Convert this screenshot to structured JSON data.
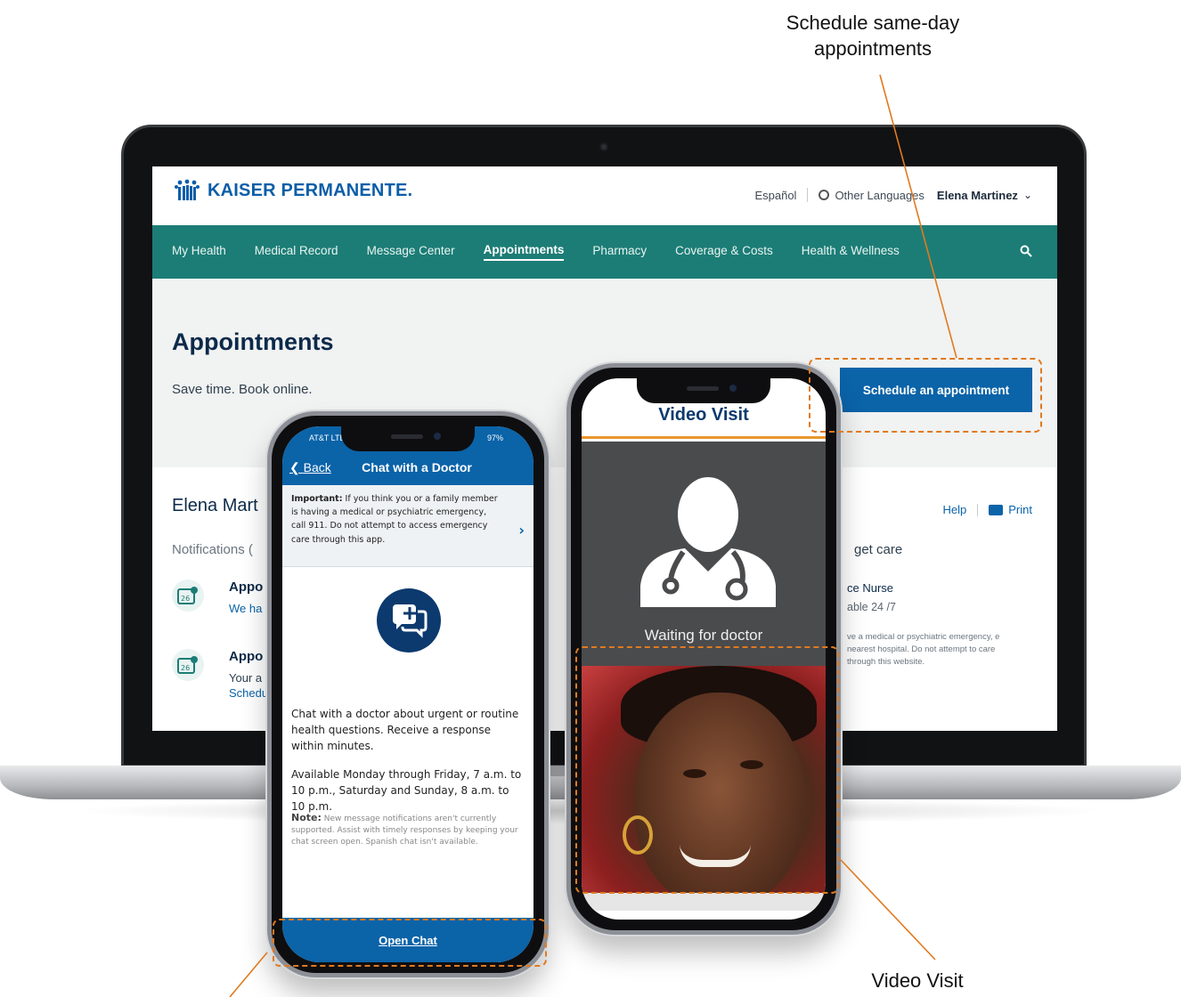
{
  "callouts": {
    "top_line1": "Schedule same-day",
    "top_line2": "appointments",
    "bottom": "Video Visit"
  },
  "colors": {
    "nav_teal": "#1c7d76",
    "brand_blue": "#0b63a8",
    "callout_orange": "#e07a1f"
  },
  "laptop": {
    "logo_text": "KAISER PERMANENTE.",
    "utility": {
      "espanol": "Español",
      "other_languages": "Other Languages",
      "user": "Elena Martinez"
    },
    "nav": [
      "My Health",
      "Medical Record",
      "Message Center",
      "Appointments",
      "Pharmacy",
      "Coverage & Costs",
      "Health & Wellness"
    ],
    "nav_active": "Appointments",
    "hero": {
      "title": "Appointments",
      "subtitle": "Save time. Book online.",
      "schedule_button": "Schedule an appointment"
    },
    "body": {
      "member_name": "Elena Mart",
      "help": "Help",
      "print": "Print",
      "notifications": "Notifications (",
      "get_care": "get care",
      "appt1_title": "Appo",
      "appt1_line": "We ha",
      "appt2_title": "Appo",
      "appt2_line1": "Your a",
      "appt2_line2": "Schedu",
      "nurse": "ce Nurse",
      "available": "able 24 /7",
      "emergency": "ve a medical or psychiatric emergency, e nearest hospital. Do not attempt to care through this website."
    }
  },
  "chat_phone": {
    "carrier": "AT&T LTE",
    "battery": "97%",
    "back": "Back",
    "title": "Chat with a Doctor",
    "important_label": "Important:",
    "important_text": "If you think you or a family member is having a medical or psychiatric emergency, call 911. Do not attempt to access emergency care through this app.",
    "description": "Chat with a doctor about urgent or routine health questions. Receive a response within minutes.",
    "availability": "Available Monday through Friday, 7 a.m. to 10 p.m., Saturday and Sunday, 8 a.m. to 10 p.m.",
    "note_label": "Note:",
    "note_text": "New message notifications aren't currently supported. Assist with timely responses by keeping your chat screen open. Spanish chat isn't available.",
    "open_chat": "Open Chat"
  },
  "video_phone": {
    "title": "Video Visit",
    "waiting": "Waiting for doctor"
  }
}
